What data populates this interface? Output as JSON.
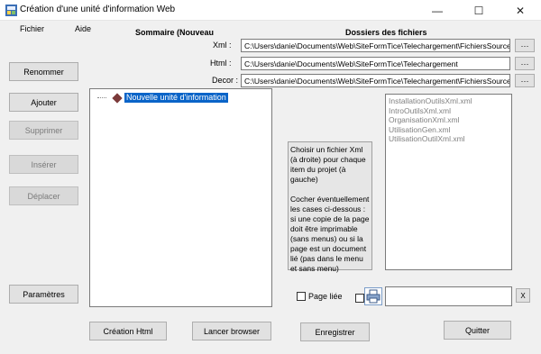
{
  "window": {
    "title": "Création d'une unité d'information Web",
    "minimize": "—",
    "maximize": "☐",
    "close": "✕"
  },
  "menu": [
    "Fichier",
    "Aide"
  ],
  "left_buttons": {
    "rename": "Renommer",
    "add": "Ajouter",
    "delete": "Supprimer",
    "insert": "Insérer",
    "move": "Déplacer",
    "settings": "Paramètres"
  },
  "summary_header": "Sommaire (Nouveau",
  "folders_header": "Dossiers des fichiers",
  "paths": {
    "xml_label": "Xml :",
    "xml_value": "C:\\Users\\danie\\Documents\\Web\\SiteFormTice\\Telechargement\\FichiersSources",
    "html_label": "Html :",
    "html_value": "C:\\Users\\danie\\Documents\\Web\\SiteFormTice\\Telechargement",
    "decor_label": "Decor :",
    "decor_value": "C:\\Users\\danie\\Documents\\Web\\SiteFormTice\\Telechargement\\FichiersSources",
    "browse": "···"
  },
  "tree": {
    "root_label": "Nouvelle unité d'information"
  },
  "xml_files": [
    "InstallationOutilsXml.xml",
    "IntroOutilsXml.xml",
    "OrganisationXml.xml",
    "UtilisationGen.xml",
    "UtilisationOutilXml.xml"
  ],
  "help": {
    "para1": "Choisir un fichier Xml (à droite) pour chaque item du projet (à gauche)",
    "para2": "Cocher éventuellement les cases ci-dessous : si une copie de la page doit être imprimable (sans menus) ou si la page est un document lié (pas dans le menu et sans menu)"
  },
  "linked_page_label": "Page liée",
  "clear_button": "X",
  "bottom_buttons": {
    "create_html": "Création Html",
    "launch_browser": "Lancer browser",
    "save": "Enregistrer",
    "quit": "Quitter"
  }
}
